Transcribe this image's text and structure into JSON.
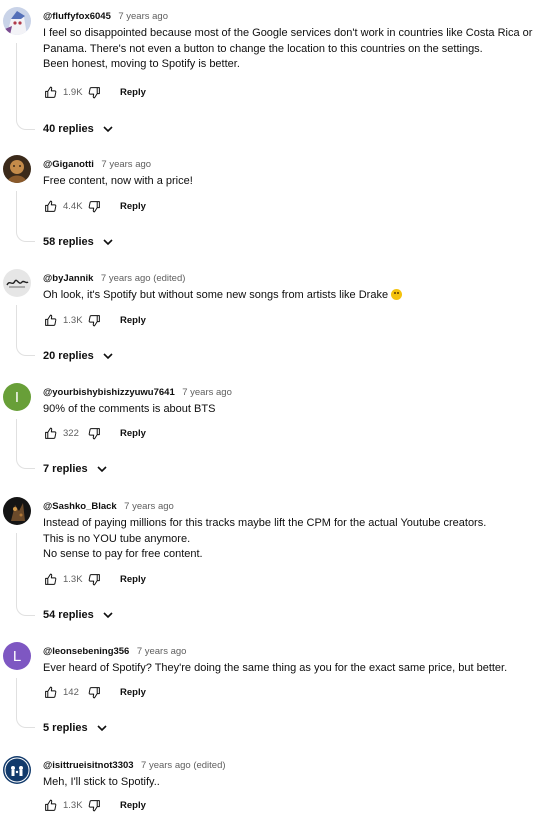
{
  "comments": [
    {
      "author": "@fluffyfox6045",
      "time": "7 years ago",
      "lines": [
        "I feel so disappointed because most of the Google services don't work in countries like Costa Rica or",
        "Panama. There's not even a button to change the location to this countries on the settings.",
        "Been honest, moving to Spotify is better."
      ],
      "likes": "1.9K",
      "reply_label": "Reply",
      "replies": "40 replies",
      "avatar": "anime-character-avatar"
    },
    {
      "author": "@Giganotti",
      "time": "7 years ago",
      "lines": [
        "Free content, now with a price!"
      ],
      "likes": "4.4K",
      "reply_label": "Reply",
      "replies": "58 replies",
      "avatar": "painting-avatar"
    },
    {
      "author": "@byJannik",
      "time": "7 years ago (edited)",
      "lines": [
        "Oh look, it's Spotify but without some new songs from artists like Drake"
      ],
      "emoji": "thinking-face-emoji",
      "likes": "1.3K",
      "reply_label": "Reply",
      "replies": "20 replies",
      "avatar": "signature-logo-avatar"
    },
    {
      "author": "@yourbishybishizzyuwu7641",
      "time": "7 years ago",
      "lines": [
        "90% of the comments is about BTS"
      ],
      "likes": "322",
      "reply_label": "Reply",
      "replies": "7 replies",
      "avatar_letter": "I",
      "avatar_color": "#689f38"
    },
    {
      "author": "@Sashko_Black",
      "time": "7 years ago",
      "lines": [
        "Instead of paying millions for this tracks maybe lift the CPM for the actual Youtube creators.",
        "This is no YOU tube anymore.",
        "No sense to pay for free content."
      ],
      "likes": "1.3K",
      "reply_label": "Reply",
      "replies": "54 replies",
      "avatar": "dark-photo-avatar"
    },
    {
      "author": "@leonsebening356",
      "time": "7 years ago",
      "lines": [
        "Ever heard of Spotify? They're doing the same thing as you for the exact same price, but better."
      ],
      "likes": "142",
      "reply_label": "Reply",
      "replies": "5 replies",
      "avatar_letter": "L",
      "avatar_color": "#7e57c2"
    },
    {
      "author": "@isittrueisitnot3303",
      "time": "7 years ago (edited)",
      "lines": [
        "Meh, I'll stick to Spotify.."
      ],
      "likes": "1.3K",
      "reply_label": "Reply",
      "avatar": "family-logo-avatar"
    }
  ]
}
